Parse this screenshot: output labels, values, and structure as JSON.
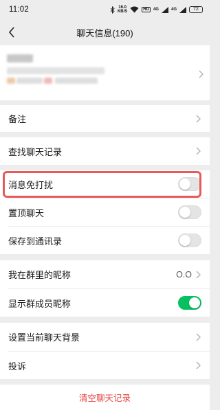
{
  "status": {
    "time": "11:02",
    "net_speed_value": "16.0",
    "net_speed_unit": "KB/S",
    "hd_label": "HD",
    "sig1": "4G",
    "sig2": "4G",
    "battery": "72"
  },
  "nav": {
    "title": "聊天信息(190)",
    "back_icon": "chevron-left-icon"
  },
  "rows": {
    "remark": "备注",
    "search_history": "查找聊天记录",
    "mute": "消息免打扰",
    "pin": "置顶聊天",
    "save_contacts": "保存到通讯录",
    "my_nickname": "我在群里的昵称",
    "my_nickname_value": "O.O",
    "show_nicknames": "显示群成员昵称",
    "set_background": "设置当前聊天背景",
    "report": "投诉",
    "clear_history": "清空聊天记录"
  },
  "toggles": {
    "mute": false,
    "pin": false,
    "save_contacts": false,
    "show_nicknames": true
  },
  "colors": {
    "accent_green": "#07c160",
    "danger_red": "#e64340",
    "highlight_red": "#e85a5a"
  }
}
